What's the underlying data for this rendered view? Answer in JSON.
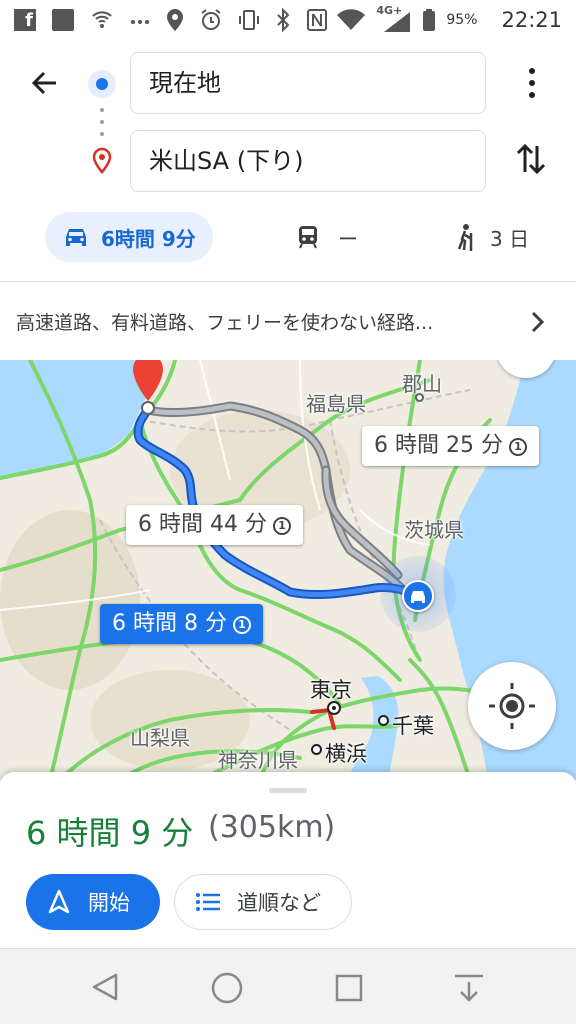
{
  "status_bar": {
    "battery": "95%",
    "time": "22:21",
    "network": "4G+",
    "left_icons": [
      "facebook-icon",
      "notification-icon",
      "wifi-calling-icon",
      "more-dots-icon",
      "location-icon",
      "alarm-icon",
      "vibrate-icon",
      "bluetooth-icon",
      "nfc-icon"
    ],
    "right_icons": [
      "wifi-icon",
      "signal-icon",
      "battery-icon"
    ]
  },
  "directions": {
    "origin": "現在地",
    "destination": "米山SA (下り)"
  },
  "modes": {
    "drive": "6時間 9分",
    "transit": "ー",
    "walk": "3 日"
  },
  "options_bar": {
    "text": "高速道路、有料道路、フェリーを使わない経路..."
  },
  "map": {
    "labels": {
      "koriyama": "郡山",
      "fukushima": "福島県",
      "ibaraki": "茨城県",
      "tokyo": "東京",
      "chiba": "千葉",
      "yamanashi": "山梨県",
      "kanagawa": "神奈川県",
      "yokohama": "横浜"
    },
    "route_labels": {
      "alt1": "6 時間 25 分",
      "alt2": "6 時間 44 分",
      "selected": "6 時間 8 分"
    },
    "toll_mark": "1",
    "colors": {
      "route_selected": "#1a73e8",
      "route_alternative": "#9aa0a6",
      "expressway": "#7cd66a",
      "sea": "#aadaff",
      "land": "#f1ece1"
    }
  },
  "sheet": {
    "duration": "6 時間 9 分",
    "distance": "(305km)",
    "start_label": "開始",
    "steps_label": "道順など"
  },
  "colors": {
    "accent": "#1a73e8",
    "duration_green": "#188038",
    "destination_red": "#d93025"
  }
}
